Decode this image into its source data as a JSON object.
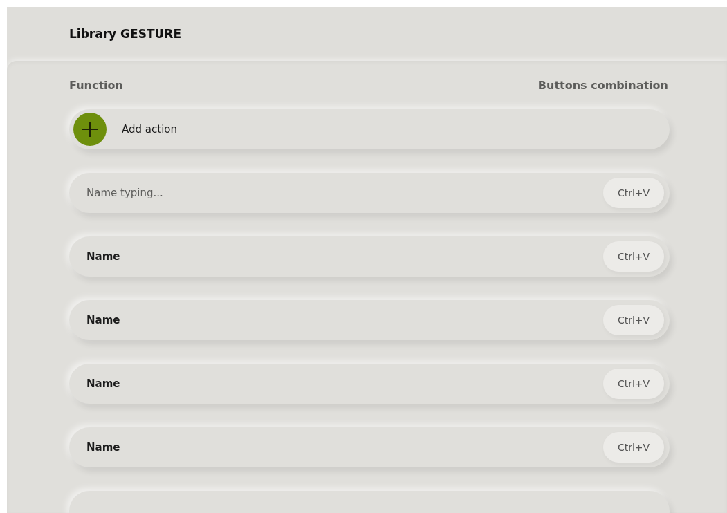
{
  "title": {
    "plain": "Library",
    "bold": "GESTURE"
  },
  "columns": [
    "Function",
    "Buttons combination"
  ],
  "add_button": {
    "label": "Add action"
  },
  "rows": [
    {
      "kind": "input",
      "placeholder": "Name typing...",
      "shortcut": "Ctrl+V"
    },
    {
      "kind": "name",
      "name": "Name",
      "shortcut": "Ctrl+V"
    },
    {
      "kind": "name",
      "name": "Name",
      "shortcut": "Ctrl+V"
    },
    {
      "kind": "name",
      "name": "Name",
      "shortcut": "Ctrl+V"
    },
    {
      "kind": "name",
      "name": "Name",
      "shortcut": "Ctrl+V"
    }
  ]
}
